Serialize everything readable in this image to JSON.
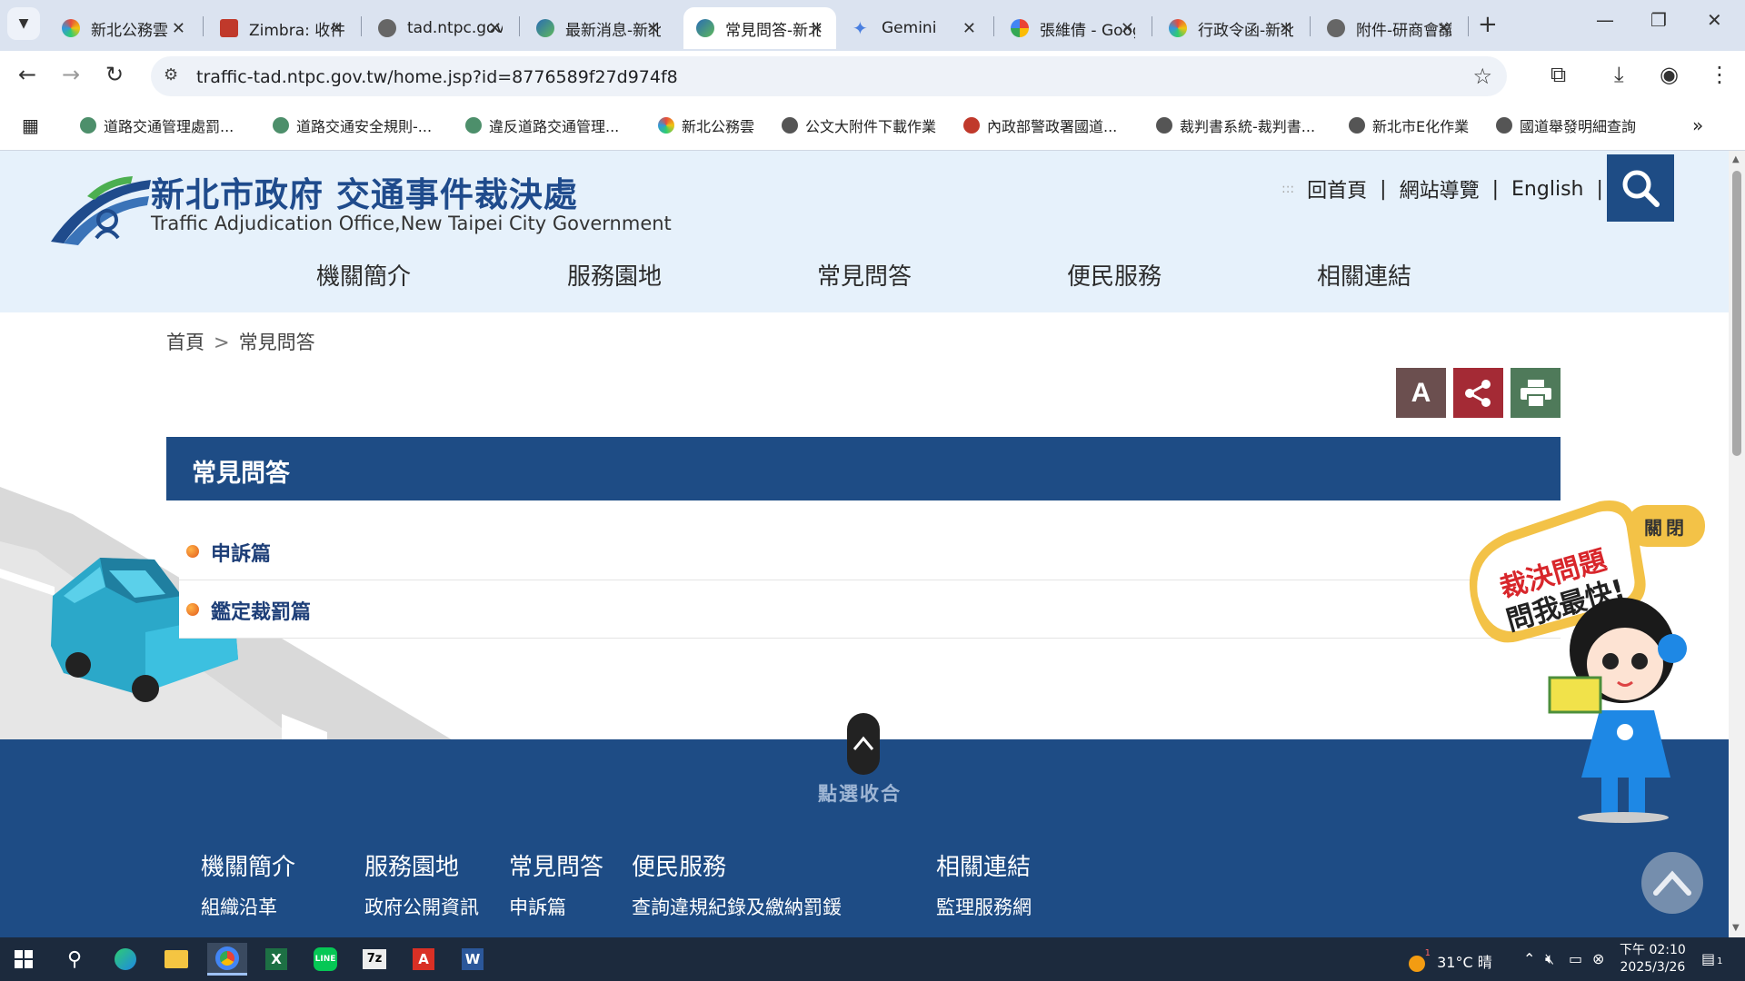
{
  "browser": {
    "tabs": [
      {
        "title": "新北公務雲",
        "active": false
      },
      {
        "title": "Zimbra: 收件匣",
        "active": false
      },
      {
        "title": "tad.ntpc.gov.tw",
        "active": false
      },
      {
        "title": "最新消息-新北",
        "active": false
      },
      {
        "title": "常見問答-新北",
        "active": true
      },
      {
        "title": "Gemini",
        "active": false
      },
      {
        "title": "張維倩 - Google",
        "active": false
      },
      {
        "title": "行政令函-新北",
        "active": false
      },
      {
        "title": "附件-研商會議",
        "active": false
      }
    ],
    "new_tab": "+",
    "url": "traffic-tad.ntpc.gov.tw/home.jsp?id=8776589f27d974f8",
    "bookmarks": [
      "道路交通管理處罰...",
      "道路交通安全規則-...",
      "違反道路交通管理...",
      "新北公務雲",
      "公文大附件下載作業",
      "內政部警政署國道...",
      "裁判書系統-裁判書...",
      "新北市E化作業",
      "國道舉發明細查詢"
    ],
    "more_bookmarks": "»"
  },
  "site": {
    "logo_cn": "新北市政府 交通事件裁決處",
    "logo_en": "Traffic Adjudication Office,New Taipei City Government",
    "top_links": [
      "回首頁",
      "網站導覽",
      "English"
    ],
    "top_links_dots": ":::",
    "main_nav": [
      "機關簡介",
      "服務園地",
      "常見問答",
      "便民服務",
      "相關連結"
    ],
    "breadcrumb": [
      "首頁",
      "常見問答"
    ],
    "tools": {
      "font_size": "A"
    },
    "section_title": "常見問答",
    "faq_items": [
      "申訴篇",
      "鑑定裁罰篇"
    ],
    "collapse_label": "點選收合",
    "mascot": {
      "bubble_line1": "裁決問題",
      "bubble_line2": "問我最快!",
      "close_label": "關閉"
    },
    "footer": {
      "columns": [
        {
          "heading": "機關簡介",
          "sub": "組織沿革"
        },
        {
          "heading": "服務園地",
          "sub": "政府公開資訊"
        },
        {
          "heading": "常見問答",
          "sub": "申訴篇"
        },
        {
          "heading": "便民服務",
          "sub": "查詢違規紀錄及繳納罰鍰"
        },
        {
          "heading": "相關連結",
          "sub": "監理服務網"
        }
      ]
    },
    "colors": {
      "primary": "#1e4c85",
      "header_bg": "#e6f1fb"
    }
  },
  "taskbar": {
    "weather": "31°C 晴",
    "weather_badge": "1",
    "time": "下午 02:10",
    "date": "2025/3/26",
    "notification_count": "1"
  }
}
